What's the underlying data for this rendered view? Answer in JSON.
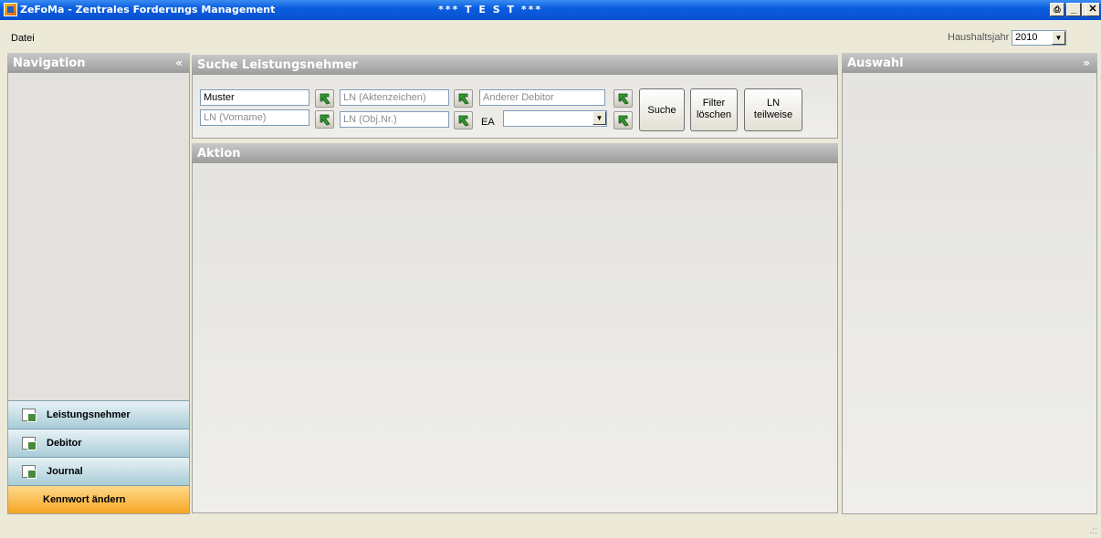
{
  "window": {
    "title": "ZeFoMa - Zentrales Forderungs Management",
    "env_label": "***     T E S T     ***",
    "buttons": [
      "print-icon",
      "minimize-icon",
      "maximize-icon",
      "close-icon"
    ]
  },
  "menu": {
    "file": "Datei"
  },
  "haushaltsjahr": {
    "label": "Haushaltsjahr",
    "value": "2010"
  },
  "navigation": {
    "title": "Navigation",
    "collapse_glyph": "«",
    "items": [
      {
        "label": "Leistungsnehmer",
        "icon": "form-add-icon"
      },
      {
        "label": "Debitor",
        "icon": "form-add-icon"
      },
      {
        "label": "Journal",
        "icon": "form-add-icon"
      },
      {
        "label": "Kennwort ändern",
        "icon": ""
      }
    ]
  },
  "search": {
    "title": "Suche Leistungsnehmer",
    "fields": {
      "name": {
        "value": "Muster"
      },
      "vorname": {
        "placeholder": "LN (Vorname)"
      },
      "aktenzeichen": {
        "placeholder": "LN (Aktenzeichen)"
      },
      "objnr": {
        "placeholder": "LN (Obj.Nr.)"
      },
      "debitor": {
        "placeholder": "Anderer Debitor"
      },
      "ea_label": "EA",
      "ea_value": ""
    },
    "buttons": {
      "suche": "Suche",
      "filter1": "Filter",
      "filter2": "löschen",
      "ln1": "LN",
      "ln2": "teilweise"
    }
  },
  "aktion": {
    "title": "Aktion"
  },
  "auswahl": {
    "title": "Auswahl",
    "expand_glyph": "»"
  },
  "colors": {
    "titlebar": "#0a5ee0",
    "panel_header": "#a8a8a8",
    "nav_button": "#b8d6e0",
    "orange_button": "#f5a623"
  }
}
